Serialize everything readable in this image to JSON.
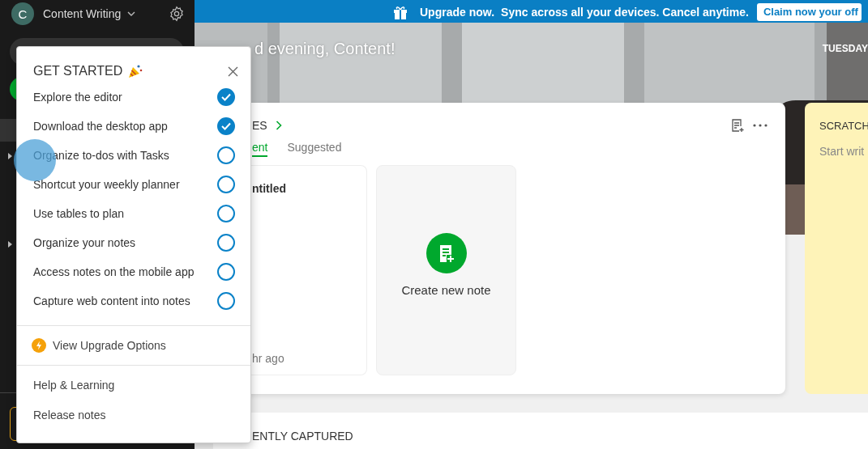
{
  "sidebar": {
    "account": {
      "initial": "C",
      "name": "Content Writing"
    }
  },
  "banner": {
    "lead": "Upgrade now.",
    "message": "Sync across all your devices. Cancel anytime.",
    "button": "Claim now your off"
  },
  "hero": {
    "greeting": "d evening, Content!",
    "date": "TUESDAY"
  },
  "notes_widget": {
    "title": "ES",
    "tabs": [
      {
        "label": "ent",
        "selected": true
      },
      {
        "label": "Suggested",
        "selected": false
      }
    ],
    "notes": [
      {
        "title": "ntitled",
        "time": "hr ago"
      }
    ],
    "create_label": "Create new note"
  },
  "scratch_pad": {
    "title": "SCRATCH",
    "placeholder": "Start writ"
  },
  "recently_captured": {
    "title": "ENTLY CAPTURED"
  },
  "get_started": {
    "title": "GET STARTED",
    "tasks": [
      {
        "label": "Explore the editor",
        "checked": true
      },
      {
        "label": "Download the desktop app",
        "checked": true
      },
      {
        "label": "Organize to-dos with Tasks",
        "checked": false
      },
      {
        "label": "Shortcut your weekly planner",
        "checked": false
      },
      {
        "label": "Use tables to plan",
        "checked": false
      },
      {
        "label": "Organize your notes",
        "checked": false
      },
      {
        "label": "Access notes on the mobile app",
        "checked": false
      },
      {
        "label": "Capture web content into notes",
        "checked": false
      }
    ],
    "upgrade": "View Upgrade Options",
    "links": [
      "Help & Learning",
      "Release notes"
    ]
  }
}
